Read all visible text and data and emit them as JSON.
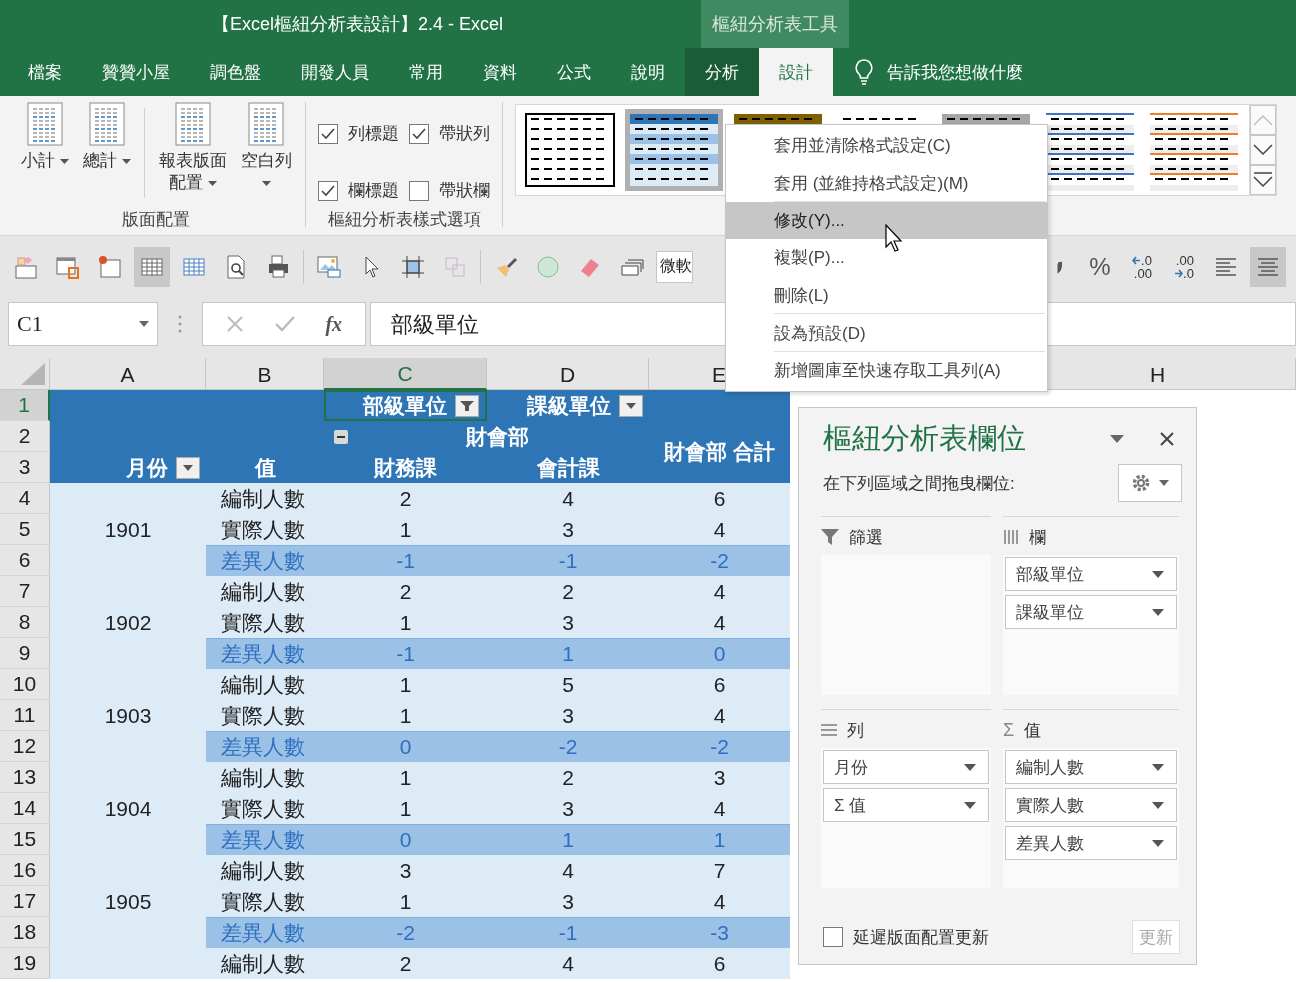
{
  "window": {
    "title": "【Excel樞紐分析表設計】2.4  -  Excel",
    "context_group": "樞紐分析表工具"
  },
  "tabs": [
    {
      "label": "檔案",
      "selected": false,
      "contextual": false
    },
    {
      "label": "贊贊小屋",
      "selected": false,
      "contextual": false
    },
    {
      "label": "調色盤",
      "selected": false,
      "contextual": false
    },
    {
      "label": "開發人員",
      "selected": false,
      "contextual": false
    },
    {
      "label": "常用",
      "selected": false,
      "contextual": false
    },
    {
      "label": "資料",
      "selected": false,
      "contextual": false
    },
    {
      "label": "公式",
      "selected": false,
      "contextual": false
    },
    {
      "label": "說明",
      "selected": false,
      "contextual": false
    },
    {
      "label": "分析",
      "selected": false,
      "contextual": true
    },
    {
      "label": "設計",
      "selected": true,
      "contextual": true
    }
  ],
  "tell_me": "告訴我您想做什麼",
  "ribbon": {
    "layout_group": {
      "label": "版面配置",
      "buttons": [
        {
          "label": "小計"
        },
        {
          "label": "總計"
        },
        {
          "label": "報表版面配置"
        },
        {
          "label": "空白列"
        }
      ]
    },
    "options_group": {
      "label": "樞紐分析表樣式選項",
      "options": [
        {
          "label": "列標題",
          "checked": true
        },
        {
          "label": "帶狀列",
          "checked": true
        },
        {
          "label": "欄標題",
          "checked": true
        },
        {
          "label": "帶狀欄",
          "checked": false
        }
      ]
    },
    "styles": [
      {
        "kind": "outline",
        "color": "#000000",
        "selected": false
      },
      {
        "kind": "banded",
        "color": "#2e75b6",
        "selected": true
      },
      {
        "kind": "header",
        "color": "#7f6000",
        "selected": false
      },
      {
        "kind": "plain",
        "color": "#000000",
        "selected": false
      },
      {
        "kind": "header",
        "color": "#a6a6a6",
        "selected": false
      },
      {
        "kind": "lined",
        "color": "#4472c4",
        "selected": false
      },
      {
        "kind": "lined",
        "color": "#ed7d31",
        "selected": false
      }
    ]
  },
  "toolbar": {
    "buttons": [
      {
        "kind": "shapes",
        "selected": false
      },
      {
        "kind": "note",
        "selected": false
      },
      {
        "kind": "bullet",
        "selected": false
      },
      {
        "kind": "table",
        "selected": true
      },
      {
        "kind": "grid",
        "selected": false
      },
      {
        "kind": "preview",
        "selected": false
      },
      {
        "kind": "print",
        "selected": false
      },
      {
        "kind": "picture",
        "selected": false
      },
      {
        "kind": "pointer",
        "selected": false
      },
      {
        "kind": "crop",
        "selected": false
      },
      {
        "kind": "group",
        "selected": false
      },
      {
        "kind": "brush",
        "selected": false
      },
      {
        "kind": "circle",
        "selected": false
      },
      {
        "kind": "eraser",
        "selected": false
      },
      {
        "kind": "stack",
        "selected": false
      }
    ],
    "font_box": "微軟",
    "right_buttons": [
      {
        "kind": "comma",
        "selected": false
      },
      {
        "kind": "text",
        "text": "%",
        "selected": false
      },
      {
        "kind": "decimal-up",
        "top": ".0",
        "bottom": ".00",
        "selected": false
      },
      {
        "kind": "decimal-down",
        "top": ".00",
        "bottom": ".0",
        "selected": false
      },
      {
        "kind": "align-left",
        "selected": false
      },
      {
        "kind": "align-center",
        "selected": true
      }
    ]
  },
  "formula_bar": {
    "name_box": "C1",
    "fx": "fx",
    "value": "部級單位"
  },
  "context_menu": [
    {
      "label": "套用並清除格式設定(C)",
      "selected": false,
      "separator_after": false
    },
    {
      "label": "套用 (並維持格式設定)(M)",
      "selected": false,
      "separator_after": true
    },
    {
      "label": "修改(Y)...",
      "selected": true,
      "separator_after": false
    },
    {
      "label": "複製(P)...",
      "selected": false,
      "separator_after": false
    },
    {
      "label": "刪除(L)",
      "selected": false,
      "separator_after": true
    },
    {
      "label": "設為預設(D)",
      "selected": false,
      "separator_after": true
    },
    {
      "label": "新增圖庫至快速存取工具列(A)",
      "selected": false,
      "separator_after": false
    }
  ],
  "sheet": {
    "columns": [
      {
        "label": "A",
        "selected": false
      },
      {
        "label": "B",
        "selected": false
      },
      {
        "label": "C",
        "selected": true
      },
      {
        "label": "D",
        "selected": false
      },
      {
        "label": "E",
        "selected": false
      },
      {
        "label": "H",
        "selected": false
      }
    ],
    "row_numbers": [
      {
        "label": "1",
        "selected": true
      },
      {
        "label": "2",
        "selected": false
      },
      {
        "label": "3",
        "selected": false
      },
      {
        "label": "4",
        "selected": false
      },
      {
        "label": "5",
        "selected": false
      },
      {
        "label": "6",
        "selected": false
      },
      {
        "label": "7",
        "selected": false
      },
      {
        "label": "8",
        "selected": false
      },
      {
        "label": "9",
        "selected": false
      },
      {
        "label": "10",
        "selected": false
      },
      {
        "label": "11",
        "selected": false
      },
      {
        "label": "12",
        "selected": false
      },
      {
        "label": "13",
        "selected": false
      },
      {
        "label": "14",
        "selected": false
      },
      {
        "label": "15",
        "selected": false
      },
      {
        "label": "16",
        "selected": false
      },
      {
        "label": "17",
        "selected": false
      },
      {
        "label": "18",
        "selected": false
      },
      {
        "label": "19",
        "selected": false
      }
    ],
    "pivot_header": {
      "column_field": "部級單位",
      "sub_field": "課級單位",
      "group": "財會部",
      "row_field": "月份",
      "values_label": "值",
      "col_1": "財務課",
      "col_2": "會計課",
      "total": "財會部 合計"
    },
    "rows": [
      {
        "month": "",
        "label": "編制人數",
        "kind": "normal",
        "values": [
          "2",
          "4",
          "6"
        ]
      },
      {
        "month": "1901",
        "label": "實際人數",
        "kind": "normal",
        "values": [
          "1",
          "3",
          "4"
        ]
      },
      {
        "month": "",
        "label": "差異人數",
        "kind": "diff",
        "values": [
          "-1",
          "-1",
          "-2"
        ]
      },
      {
        "month": "",
        "label": "編制人數",
        "kind": "normal",
        "values": [
          "2",
          "2",
          "4"
        ]
      },
      {
        "month": "1902",
        "label": "實際人數",
        "kind": "normal",
        "values": [
          "1",
          "3",
          "4"
        ]
      },
      {
        "month": "",
        "label": "差異人數",
        "kind": "diff",
        "values": [
          "-1",
          "1",
          "0"
        ]
      },
      {
        "month": "",
        "label": "編制人數",
        "kind": "normal",
        "values": [
          "1",
          "5",
          "6"
        ]
      },
      {
        "month": "1903",
        "label": "實際人數",
        "kind": "normal",
        "values": [
          "1",
          "3",
          "4"
        ]
      },
      {
        "month": "",
        "label": "差異人數",
        "kind": "diff",
        "values": [
          "0",
          "-2",
          "-2"
        ]
      },
      {
        "month": "",
        "label": "編制人數",
        "kind": "normal",
        "values": [
          "1",
          "2",
          "3"
        ]
      },
      {
        "month": "1904",
        "label": "實際人數",
        "kind": "normal",
        "values": [
          "1",
          "3",
          "4"
        ]
      },
      {
        "month": "",
        "label": "差異人數",
        "kind": "diff",
        "values": [
          "0",
          "1",
          "1"
        ]
      },
      {
        "month": "",
        "label": "編制人數",
        "kind": "normal",
        "values": [
          "3",
          "4",
          "7"
        ]
      },
      {
        "month": "1905",
        "label": "實際人數",
        "kind": "normal",
        "values": [
          "1",
          "3",
          "4"
        ]
      },
      {
        "month": "",
        "label": "差異人數",
        "kind": "diff",
        "values": [
          "-2",
          "-1",
          "-3"
        ]
      },
      {
        "month": "",
        "label": "編制人數",
        "kind": "normal",
        "values": [
          "2",
          "4",
          "6"
        ]
      }
    ]
  },
  "field_pane": {
    "title": "樞紐分析表欄位",
    "hint": "在下列區域之間拖曳欄位:",
    "areas": [
      {
        "kind": "filter",
        "label": "篩選"
      },
      {
        "kind": "columns",
        "label": "欄",
        "fields": [
          {
            "label": "部級單位"
          },
          {
            "label": "課級單位"
          }
        ]
      },
      {
        "kind": "rows",
        "label": "列",
        "fields": [
          {
            "label": "月份"
          },
          {
            "label": "Σ 值"
          }
        ]
      },
      {
        "kind": "values",
        "symbol": "Σ",
        "label": "值",
        "fields": [
          {
            "label": "編制人數"
          },
          {
            "label": "實際人數"
          },
          {
            "label": "差異人數"
          }
        ]
      }
    ],
    "defer": {
      "label": "延遲版面配置更新",
      "checked": false
    },
    "update": {
      "label": "更新",
      "disabled": true
    }
  }
}
